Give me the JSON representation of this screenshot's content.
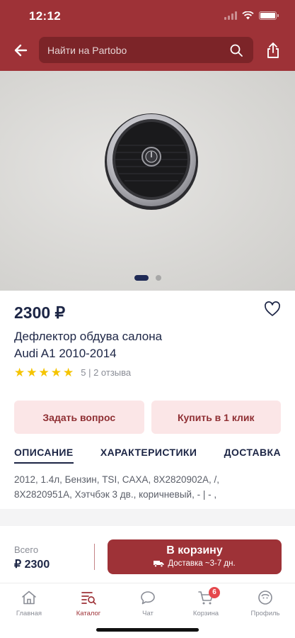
{
  "status_bar": {
    "time": "12:12"
  },
  "header": {
    "search_placeholder": "Найти на Partobo",
    "icons": [
      "back-arrow-icon",
      "search-icon",
      "share-icon"
    ]
  },
  "gallery": {
    "slides": 2,
    "active_slide": 1
  },
  "product": {
    "price": "2300 ₽",
    "title_line1": "Дефлектор обдува салона",
    "title_line2": "Audi A1 2010-2014",
    "stars": 5,
    "rating_text": "5 | 2 отзыва"
  },
  "actions": {
    "ask_question": "Задать вопрос",
    "buy_one_click": "Купить в 1 клик"
  },
  "tabs": [
    {
      "label": "ОПИСАНИЕ",
      "active": true
    },
    {
      "label": "ХАРАКТЕРИСТИКИ",
      "active": false
    },
    {
      "label": "ДОСТАВКА",
      "active": false
    }
  ],
  "description": {
    "line1": "2012, 1.4л, Бензин, TSI, CAXA, 8X2820902A, /,",
    "line2": "8X2820951A, Хэтчбэк 3 дв., коричневый, - | - ,"
  },
  "cart": {
    "total_label": "Всего",
    "total_value": "₽ 2300",
    "button_label": "В корзину",
    "delivery_text": "Доставка ~3-7 дн."
  },
  "tabbar": {
    "items": [
      {
        "label": "Главная",
        "icon": "home-icon"
      },
      {
        "label": "Каталог",
        "icon": "catalog-icon",
        "active": true
      },
      {
        "label": "Чат",
        "icon": "chat-icon"
      },
      {
        "label": "Корзина",
        "icon": "cart-icon",
        "badge": "6"
      },
      {
        "label": "Профиль",
        "icon": "profile-icon"
      }
    ]
  },
  "colors": {
    "brand": "#9e3237",
    "brand_dark": "#7c2428",
    "text_dark": "#1c2545",
    "star": "#f5c400",
    "soft_button_bg": "#fbe6e7"
  }
}
